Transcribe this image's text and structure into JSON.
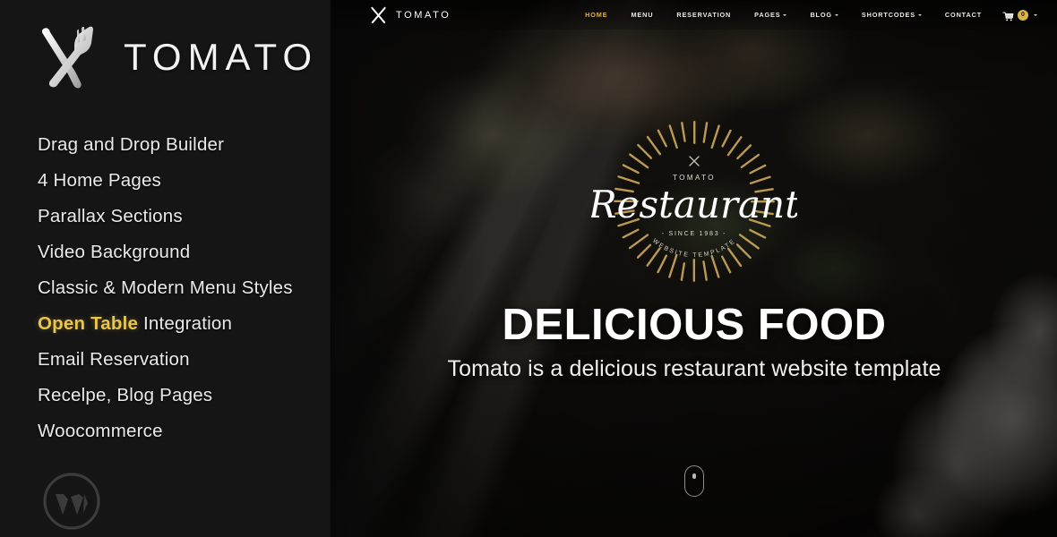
{
  "sidebar": {
    "brand_name": "TOMATO",
    "logo_icon": "crossed-fork-knife-icon",
    "features": [
      {
        "text": "Drag and Drop Builder",
        "highlight": ""
      },
      {
        "text": "4 Home Pages",
        "highlight": ""
      },
      {
        "text": "Parallax Sections",
        "highlight": ""
      },
      {
        "text": "Video Background",
        "highlight": ""
      },
      {
        "text": "Classic & Modern Menu Styles",
        "highlight": ""
      },
      {
        "text": " Integration",
        "highlight": "Open Table"
      },
      {
        "text": "Email Reservation",
        "highlight": ""
      },
      {
        "text": "Recelpe, Blog Pages",
        "highlight": ""
      },
      {
        "text": "Woocommerce",
        "highlight": ""
      }
    ],
    "platform_icon": "wordpress-icon",
    "background_color": "#151515",
    "highlight_color": "#e9c54a"
  },
  "hero": {
    "navbar": {
      "brand_name": "TOMATO",
      "brand_icon": "crossed-fork-knife-icon",
      "links": [
        {
          "label": "HOME",
          "has_caret": false,
          "active": true
        },
        {
          "label": "MENU",
          "has_caret": false,
          "active": false
        },
        {
          "label": "RESERVATION",
          "has_caret": false,
          "active": false
        },
        {
          "label": "PAGES",
          "has_caret": true,
          "active": false
        },
        {
          "label": "BLOG",
          "has_caret": true,
          "active": false
        },
        {
          "label": "SHORTCODES",
          "has_caret": true,
          "active": false
        },
        {
          "label": "CONTACT",
          "has_caret": false,
          "active": false
        }
      ],
      "cart": {
        "icon": "shopping-cart-icon",
        "count": "0",
        "has_caret": true
      },
      "active_color": "#d9b44a"
    },
    "emblem": {
      "top_text": "TOMATO",
      "script_text": "Restaurant",
      "since_text": "- SINCE 1983 -",
      "arc_text": "WEBSITE TEMPLATE",
      "ray_color": "#c9a65a"
    },
    "title": "DELICIOUS FOOD",
    "subtitle": "Tomato is a delicious restaurant website template",
    "scroll_indicator": "mouse-scroll-icon"
  }
}
